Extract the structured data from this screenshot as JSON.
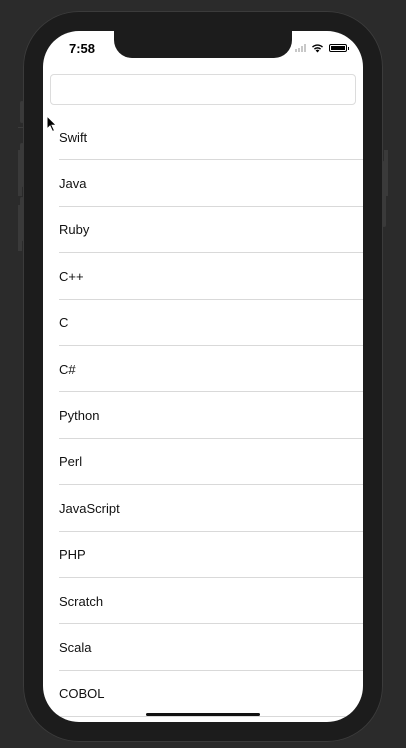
{
  "status_bar": {
    "time": "7:58"
  },
  "search": {
    "value": "",
    "placeholder": ""
  },
  "languages": [
    "Swift",
    "Java",
    "Ruby",
    "C++",
    "C",
    "C#",
    "Python",
    "Perl",
    "JavaScript",
    "PHP",
    "Scratch",
    "Scala",
    "COBOL"
  ],
  "icons": {
    "signal": "cellular-signal-icon",
    "wifi": "wifi-icon",
    "battery": "battery-icon",
    "cursor": "mouse-pointer-icon"
  },
  "colors": {
    "background": "#2b2b2b",
    "device": "#1c1c1c",
    "screen": "#ffffff",
    "separator": "#d9d9d9"
  }
}
